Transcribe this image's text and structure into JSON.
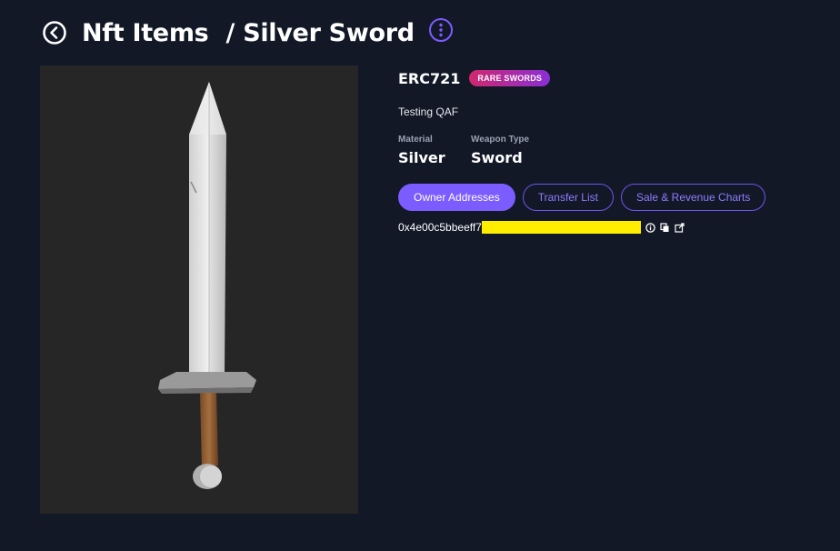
{
  "header": {
    "back_icon": "back-arrow-circle-icon",
    "collection": "Nft Items",
    "separator": "/",
    "item_name": "Silver Sword",
    "menu_icon": "more-vertical-icon"
  },
  "media": {
    "icon": "sword-image"
  },
  "info": {
    "standard": "ERC721",
    "badge": "RARE SWORDS",
    "description": "Testing QAF",
    "attributes": [
      {
        "label": "Material",
        "value": "Silver"
      },
      {
        "label": "Weapon Type",
        "value": "Sword"
      }
    ],
    "tabs": [
      {
        "label": "Owner Addresses",
        "active": true
      },
      {
        "label": "Transfer List",
        "active": false
      },
      {
        "label": "Sale & Revenue Charts",
        "active": false
      }
    ],
    "address": "0x4e00c5bbeeff7",
    "address_icons": [
      "info-icon",
      "copy-icon",
      "external-link-icon"
    ]
  },
  "colors": {
    "background": "#121826",
    "accent": "#7b5cff",
    "badge_gradient_start": "#d0286f",
    "badge_gradient_end": "#8a2fd6",
    "redaction": "#ffee00"
  }
}
